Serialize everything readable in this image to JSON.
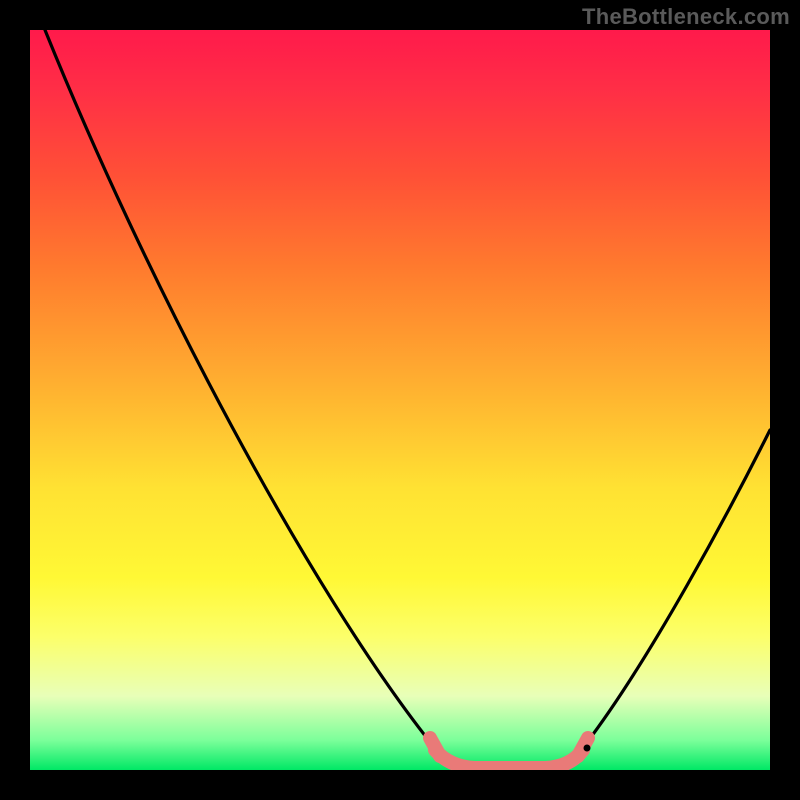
{
  "watermark": "TheBottleneck.com",
  "chart_data": {
    "type": "line",
    "title": "",
    "xlabel": "",
    "ylabel": "",
    "xlim": [
      0,
      100
    ],
    "ylim": [
      0,
      100
    ],
    "series": [
      {
        "name": "bottleneck-curve",
        "x": [
          0,
          10,
          20,
          30,
          40,
          50,
          55,
          59,
          62,
          65,
          70,
          73,
          78,
          85,
          92,
          100
        ],
        "values": [
          100,
          85,
          70,
          55,
          40,
          23,
          12,
          3,
          1,
          1,
          1,
          3,
          10,
          22,
          34,
          48
        ]
      }
    ],
    "annotations": [
      {
        "name": "plateau-marker",
        "x_range": [
          57,
          72
        ],
        "color": "#e97a78",
        "thickness": 12
      },
      {
        "name": "left-plateau-end",
        "x": 57.5,
        "color": "#e97a78"
      },
      {
        "name": "right-plateau-end",
        "x": 72,
        "color": "#e97a78"
      }
    ],
    "gradient_stops": [
      {
        "pct": 0,
        "color": "#ff1a4b"
      },
      {
        "pct": 50,
        "color": "#ffd633"
      },
      {
        "pct": 100,
        "color": "#00e865"
      }
    ]
  }
}
